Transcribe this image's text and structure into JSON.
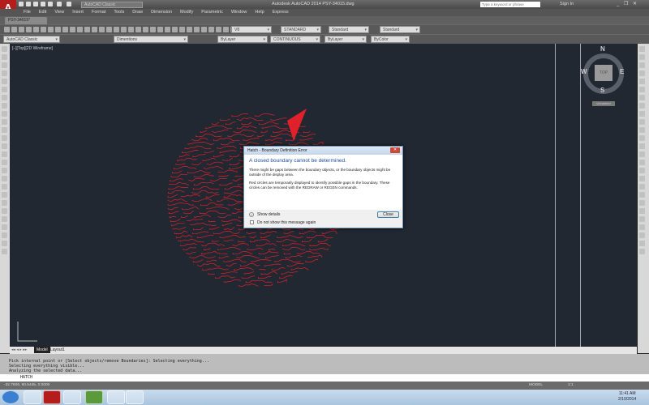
{
  "app": {
    "title": "Autodesk AutoCAD 2014    PSY-34015.dwg",
    "logo": "A",
    "workspace": "AutoCAD Classic",
    "search_placeholder": "Type a keyword or phrase",
    "sign_in": "Sign In",
    "window_controls": "_ ❐ ✕"
  },
  "menu": [
    "File",
    "Edit",
    "View",
    "Insert",
    "Format",
    "Tools",
    "Draw",
    "Dimension",
    "Modify",
    "Parametric",
    "Window",
    "Help",
    "Express"
  ],
  "doc_tab": "PSY-34015*",
  "toolbar1": {
    "layer_combo": "V8",
    "text_style": "STANDARD",
    "dim_style": "Standard",
    "table_style": "Standard"
  },
  "toolbar2": {
    "workspace": "AutoCAD Classic",
    "layer": "Dimentions",
    "color": "ByLayer",
    "linetype": "CONTINUOUS",
    "lineweight": "ByLayer",
    "plotstyle": "ByColor"
  },
  "viewport_label": "[–][Top][2D Wireframe]",
  "viewcube": {
    "top": "TOP",
    "n": "N",
    "s": "S",
    "e": "E",
    "w": "W",
    "ucs": "Unnamed"
  },
  "layout_tabs": [
    "Model",
    "Layout1"
  ],
  "dialog": {
    "title": "Hatch - Boundary Definition Error",
    "close_x": "✕",
    "heading": "A closed boundary cannot be determined.",
    "para1": "There might be gaps between the boundary objects, or the boundary objects might be outside of the display area.",
    "para2": "Red circles are temporarily displayed to identify possible gaps in the boundary. These circles can be removed with the REDRAW or REGEN commands.",
    "show_details": "Show details",
    "dont_show": "Do not show this message again",
    "close_button": "Close"
  },
  "command_history": [
    "Pick internal point or [Select objects/remove Boundaries]: Selecting everything...",
    "Selecting everything visible...",
    "Analyzing the selected data..."
  ],
  "command_input": "HATCH",
  "status": {
    "coords": "-32.7609, 60.5445, 0.0000",
    "model": "MODEL",
    "scale": "1:1"
  },
  "clock": {
    "time": "11:41 AM",
    "date": "2/10/2014"
  },
  "colors": {
    "hatch": "#e0202a",
    "drawing_bg": "#222831",
    "accent": "#1f4fa0"
  }
}
